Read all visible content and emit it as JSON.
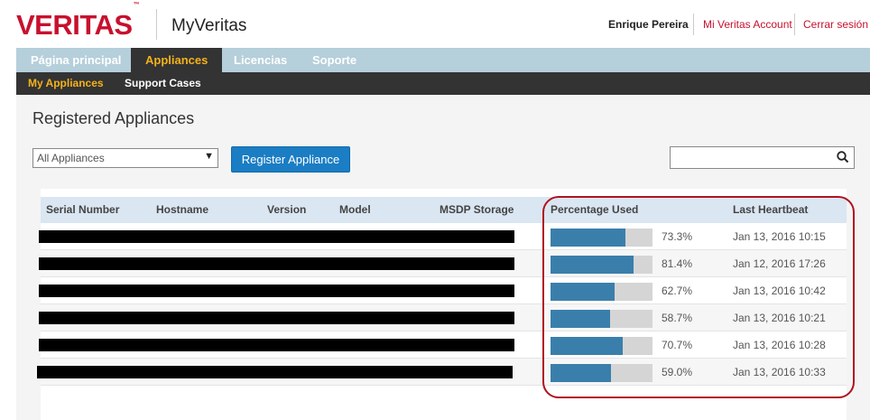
{
  "header": {
    "logo_text": "VERITAS",
    "logo_mark": "™",
    "app_name": "MyVeritas",
    "user_name": "Enrique Pereira",
    "account_link": "Mi Veritas Account",
    "logout_link": "Cerrar sesión",
    "brand_color": "#c8102e"
  },
  "main_nav": {
    "tabs": [
      {
        "label": "Página principal"
      },
      {
        "label": "Appliances",
        "active": true
      },
      {
        "label": "Licencias"
      },
      {
        "label": "Soporte"
      }
    ]
  },
  "sub_nav": {
    "items": [
      {
        "label": "My Appliances",
        "active": true
      },
      {
        "label": "Support Cases"
      }
    ]
  },
  "page": {
    "title": "Registered Appliances",
    "filter_value": "All Appliances",
    "register_button": "Register Appliance",
    "search_value": ""
  },
  "table": {
    "columns": [
      "Serial Number",
      "Hostname",
      "Version",
      "Model",
      "MSDP Storage",
      "Percentage Used",
      "Last Heartbeat"
    ],
    "rows": [
      {
        "percentage": "73.3%",
        "fraction": 0.733,
        "heartbeat": "Jan 13, 2016 10:15"
      },
      {
        "percentage": "81.4%",
        "fraction": 0.814,
        "heartbeat": "Jan 12, 2016 17:26"
      },
      {
        "percentage": "62.7%",
        "fraction": 0.627,
        "heartbeat": "Jan 13, 2016 10:42"
      },
      {
        "percentage": "58.7%",
        "fraction": 0.587,
        "heartbeat": "Jan 13, 2016 10:21"
      },
      {
        "percentage": "70.7%",
        "fraction": 0.707,
        "heartbeat": "Jan 13, 2016 10:28"
      },
      {
        "percentage": "59.0%",
        "fraction": 0.59,
        "heartbeat": "Jan 13, 2016 10:33"
      }
    ]
  },
  "colors": {
    "nav_bar": "#b5cfdb",
    "active_tab": "#f5b21a",
    "bar_fill": "#3a7fab",
    "button": "#1b7dc3",
    "highlight": "#b1121e"
  }
}
